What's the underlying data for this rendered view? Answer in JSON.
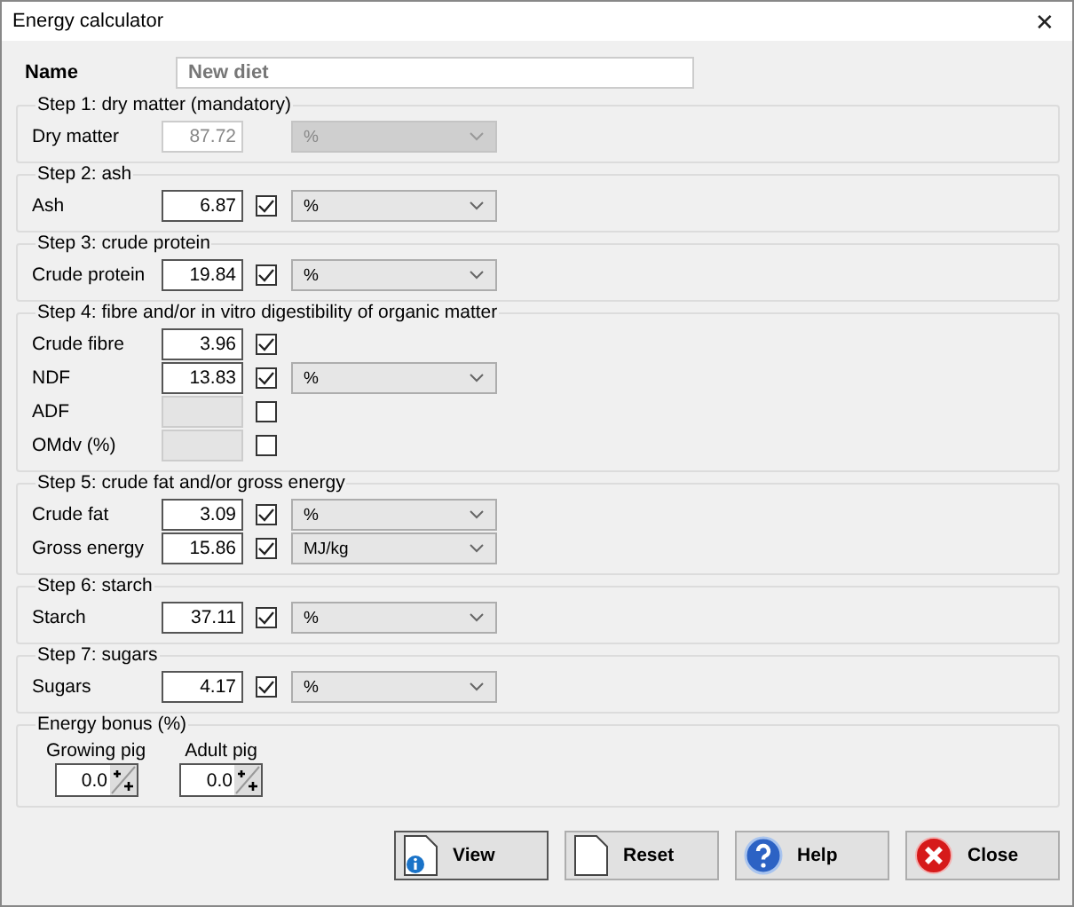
{
  "window": {
    "title": "Energy calculator",
    "close": "✕"
  },
  "name_field": {
    "label": "Name",
    "value": "New diet"
  },
  "groups": [
    {
      "title": "Step 1: dry matter (mandatory)",
      "rows": [
        {
          "label": "Dry matter",
          "value": "87.72",
          "kind": "readonly",
          "unit": {
            "text": "%",
            "disabled": true
          }
        }
      ]
    },
    {
      "title": "Step 2: ash",
      "rows": [
        {
          "label": "Ash",
          "value": "6.87",
          "kind": "normal",
          "checked": true,
          "unit": {
            "text": "%",
            "disabled": false
          }
        }
      ]
    },
    {
      "title": "Step 3: crude protein",
      "rows": [
        {
          "label": "Crude protein",
          "value": "19.84",
          "kind": "normal",
          "checked": true,
          "unit": {
            "text": "%",
            "disabled": false
          }
        }
      ]
    },
    {
      "title": "Step 4: fibre and/or in vitro digestibility of organic matter",
      "rows": [
        {
          "label": "Crude fibre",
          "value": "3.96",
          "kind": "normal",
          "checked": true
        },
        {
          "label": "NDF",
          "value": "13.83",
          "kind": "normal",
          "checked": true,
          "unit": {
            "text": "%",
            "disabled": false
          }
        },
        {
          "label": "ADF",
          "kind": "disabled",
          "checked": false
        },
        {
          "label": "OMdv (%)",
          "kind": "disabled",
          "checked": false
        }
      ]
    },
    {
      "title": "Step 5: crude fat and/or gross energy",
      "rows": [
        {
          "label": "Crude fat",
          "value": "3.09",
          "kind": "normal",
          "checked": true,
          "unit": {
            "text": "%",
            "disabled": false
          }
        },
        {
          "label": "Gross energy",
          "value": "15.86",
          "kind": "normal",
          "checked": true,
          "unit": {
            "text": "MJ/kg",
            "disabled": false
          }
        }
      ]
    },
    {
      "title": "Step 6: starch",
      "rows": [
        {
          "label": "Starch",
          "value": "37.11",
          "kind": "normal",
          "checked": true,
          "unit": {
            "text": "%",
            "disabled": false
          }
        }
      ]
    },
    {
      "title": "Step 7: sugars",
      "rows": [
        {
          "label": "Sugars",
          "value": "4.17",
          "kind": "normal",
          "checked": true,
          "unit": {
            "text": "%",
            "disabled": false
          }
        }
      ]
    }
  ],
  "energy_bonus": {
    "title": "Energy bonus (%)",
    "fields": [
      {
        "label": "Growing pig",
        "value": "0.0"
      },
      {
        "label": "Adult pig",
        "value": "0.0"
      }
    ]
  },
  "buttons": [
    {
      "label": "View",
      "kind": "info"
    },
    {
      "label": "Reset",
      "kind": "page"
    },
    {
      "label": "Help",
      "kind": "help"
    },
    {
      "label": "Close",
      "kind": "close"
    }
  ]
}
